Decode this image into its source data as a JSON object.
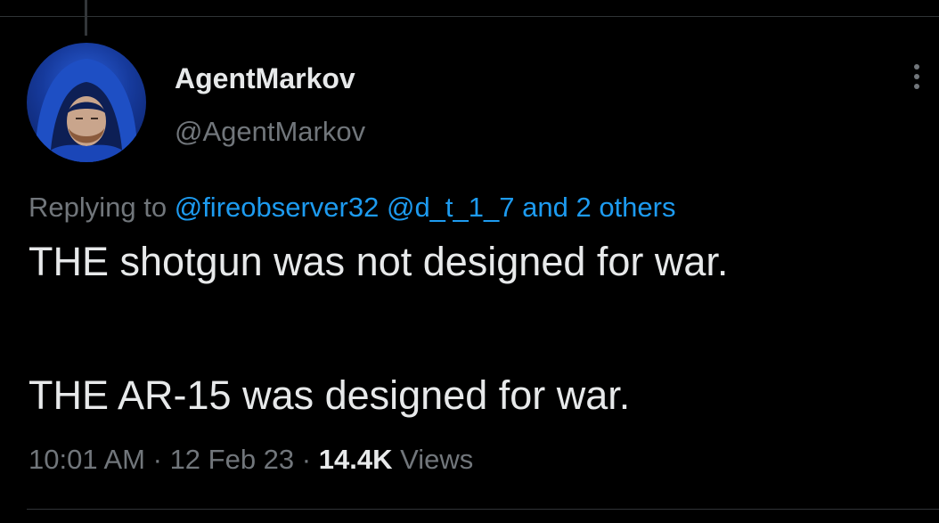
{
  "tweet": {
    "author": {
      "display_name": "AgentMarkov",
      "handle": "@AgentMarkov"
    },
    "reply": {
      "prefix": "Replying to",
      "mentions": [
        "@fireobserver32",
        "@d_t_1_7"
      ],
      "others": "and 2 others"
    },
    "text": {
      "line1": "THE shotgun was not designed for war.",
      "line2": "THE AR-15 was designed for war."
    },
    "meta": {
      "time": "10:01 AM",
      "separator": "·",
      "date": "12 Feb 23",
      "views_count": "14.4K",
      "views_label": "Views"
    }
  },
  "icons": {
    "more": "more-vertical-icon",
    "avatar": "avatar-hooded-figure"
  },
  "colors": {
    "background": "#000000",
    "primary_text": "#e7e9ea",
    "secondary_text": "#71767b",
    "link": "#1d9bf0",
    "border": "#2f3336"
  }
}
